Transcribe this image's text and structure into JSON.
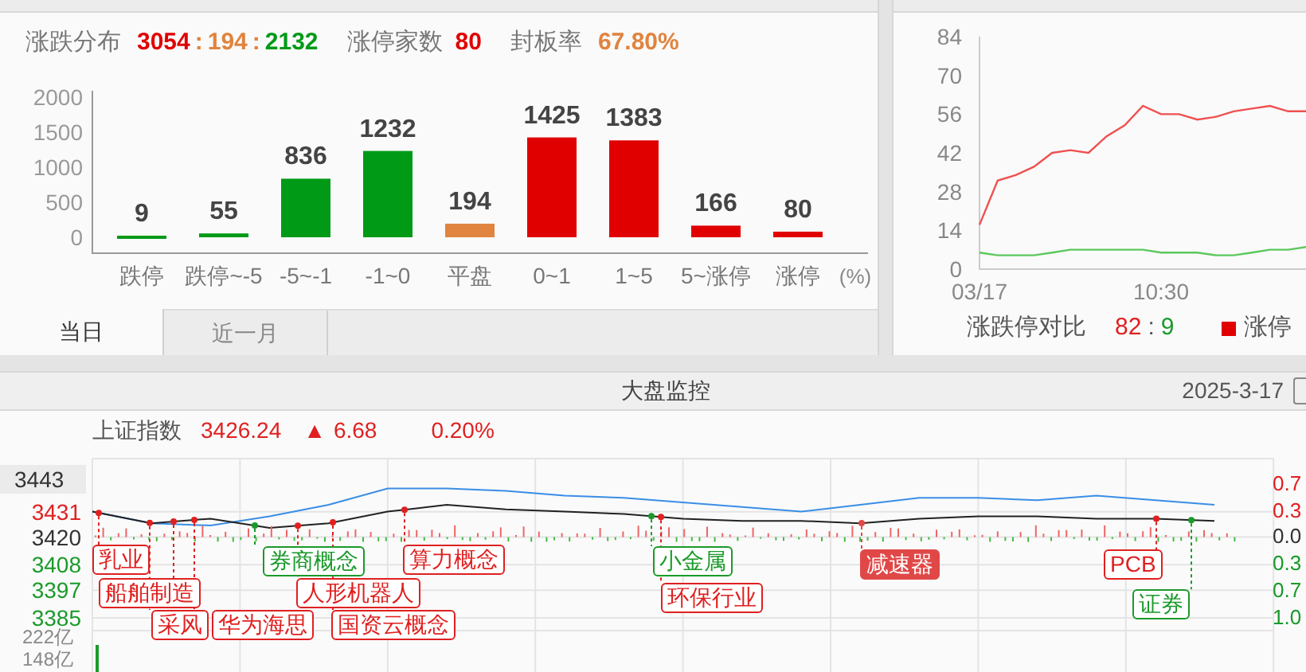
{
  "distribution": {
    "label": "涨跌分布",
    "up": "3054",
    "flat": "194",
    "down": "2132",
    "separator": ":",
    "limit_label": "涨停家数",
    "limit_value": "80",
    "seal_label": "封板率",
    "seal_value": "67.80%",
    "chart_data": {
      "type": "bar",
      "categories": [
        "跌停",
        "跌停~-5",
        "-5~-1",
        "-1~0",
        "平盘",
        "0~1",
        "1~5",
        "5~涨停",
        "涨停"
      ],
      "xlabel": "(%)",
      "ylim": [
        0,
        2000
      ],
      "yticks": [
        0,
        500,
        1000,
        1500,
        2000
      ],
      "stacked": true,
      "data_labels": true,
      "series": [
        {
          "color": "#009a16",
          "values": [
            9,
            55,
            836,
            1232,
            null,
            null,
            null,
            null,
            null
          ]
        },
        {
          "color": "#e0843f",
          "values": [
            null,
            null,
            null,
            null,
            194,
            null,
            null,
            null,
            null
          ]
        },
        {
          "color": "#e00000",
          "values": [
            null,
            null,
            null,
            null,
            null,
            1425,
            1383,
            166,
            80
          ]
        }
      ]
    },
    "tabs": [
      {
        "label": "当日",
        "selected": true
      },
      {
        "label": "近一月",
        "selected": false
      }
    ]
  },
  "limit_compare": {
    "chart_data": {
      "type": "line",
      "categories": [
        "03/17",
        null,
        null,
        null,
        null,
        null,
        null,
        null,
        null,
        null,
        "10:30",
        null,
        null,
        null,
        null,
        null,
        null,
        null,
        null
      ],
      "ylim": [
        0,
        84
      ],
      "yticks": [
        0,
        14,
        28,
        42,
        56,
        70,
        84
      ],
      "series": [
        {
          "color": "#f05050",
          "values": [
            16,
            32,
            34,
            37,
            42,
            43,
            42,
            48,
            52,
            59,
            56,
            56,
            54,
            55,
            57,
            58,
            59,
            57,
            57
          ]
        },
        {
          "color": "#5cc85c",
          "values": [
            6,
            5,
            5,
            5,
            6,
            7,
            7,
            7,
            7,
            7,
            6,
            6,
            6,
            5,
            5,
            6,
            7,
            7,
            8
          ]
        }
      ]
    },
    "legend_label": "涨跌停对比",
    "up": "82",
    "separator": ":",
    "down": "9",
    "series_label": "涨停"
  },
  "monitor": {
    "title": "大盘监控",
    "date": "2025-3-17",
    "index_name": "上证指数",
    "index_value": "3426.24",
    "change_arrow": "▲",
    "change": "6.68",
    "change_pct": "0.20%",
    "cursor_label": "3443",
    "right_axis": [
      {
        "label": "0.7",
        "kind": "up"
      },
      {
        "label": "0.3",
        "kind": "up"
      },
      {
        "label": "0.0",
        "kind": "flat"
      },
      {
        "label": "0.3",
        "kind": "down"
      },
      {
        "label": "0.7",
        "kind": "down"
      },
      {
        "label": "1.0",
        "kind": "down"
      }
    ],
    "volume_axis": [
      "222亿",
      "148亿"
    ],
    "chart_data": {
      "type": "line",
      "ylim": [
        3385,
        3454
      ],
      "yticks": [
        3431,
        3420,
        3408,
        3397,
        3385
      ],
      "grid": true,
      "series": [
        {
          "color": "#3a8ee6",
          "values": [
            3431,
            3426,
            3425,
            3429,
            3434,
            3441,
            3441,
            3440,
            3438,
            3437,
            3435,
            3433,
            3431,
            3434,
            3437,
            3437,
            3436,
            3438,
            3436,
            3434
          ]
        },
        {
          "color": "#222222",
          "values": [
            3431,
            3426,
            3428,
            3424,
            3426,
            3431,
            3434,
            3432,
            3431,
            3430,
            3428,
            3427,
            3427,
            3426,
            3428,
            3429,
            3429,
            3428,
            3428,
            3427
          ]
        }
      ]
    },
    "tags": [
      {
        "text": "乳业",
        "color": "#e02020",
        "filled": false
      },
      {
        "text": "船舶制造",
        "color": "#e02020",
        "filled": false
      },
      {
        "text": "采风",
        "color": "#e02020",
        "filled": false
      },
      {
        "text": "华为海思",
        "color": "#e02020",
        "filled": false
      },
      {
        "text": "券商概念",
        "color": "#1a9a2a",
        "filled": false
      },
      {
        "text": "人形机器人",
        "color": "#e02020",
        "filled": false
      },
      {
        "text": "国资云概念",
        "color": "#e02020",
        "filled": false
      },
      {
        "text": "算力概念",
        "color": "#e02020",
        "filled": false
      },
      {
        "text": "小金属",
        "color": "#1a9a2a",
        "filled": false
      },
      {
        "text": "环保行业",
        "color": "#e02020",
        "filled": false
      },
      {
        "text": "减速器",
        "color": "#e04848",
        "filled": true
      },
      {
        "text": "PCB",
        "color": "#e02020",
        "filled": false
      },
      {
        "text": "证券",
        "color": "#1a9a2a",
        "filled": false
      }
    ]
  }
}
